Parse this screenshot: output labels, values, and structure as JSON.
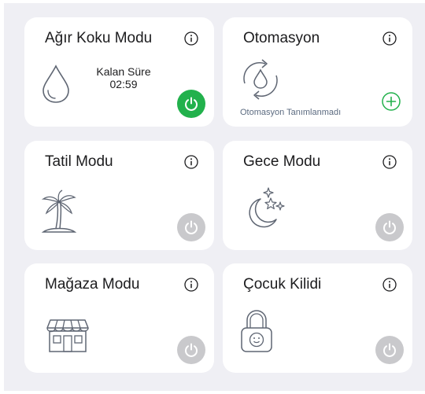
{
  "colors": {
    "background": "#efeff4",
    "card": "#ffffff",
    "active_power": "#22b14c",
    "inactive_power": "#c9c9cc",
    "icon_stroke": "#5f6673",
    "add_green": "#22b14c"
  },
  "cards": [
    {
      "title": "Ağır Koku Modu",
      "icon": "water-drop-icon",
      "remaining_label": "Kalan Süre",
      "remaining_time": "02:59",
      "power_state": "on"
    },
    {
      "title": "Otomasyon",
      "icon": "automation-cycle-icon",
      "empty_text": "Otomasyon Tanımlanmadı",
      "action_icon": "add-icon"
    },
    {
      "title": "Tatil Modu",
      "icon": "palm-tree-icon",
      "power_state": "off"
    },
    {
      "title": "Gece Modu",
      "icon": "moon-stars-icon",
      "power_state": "off"
    },
    {
      "title": "Mağaza Modu",
      "icon": "store-icon",
      "power_state": "off"
    },
    {
      "title": "Çocuk Kilidi",
      "icon": "child-lock-icon",
      "power_state": "off"
    }
  ]
}
